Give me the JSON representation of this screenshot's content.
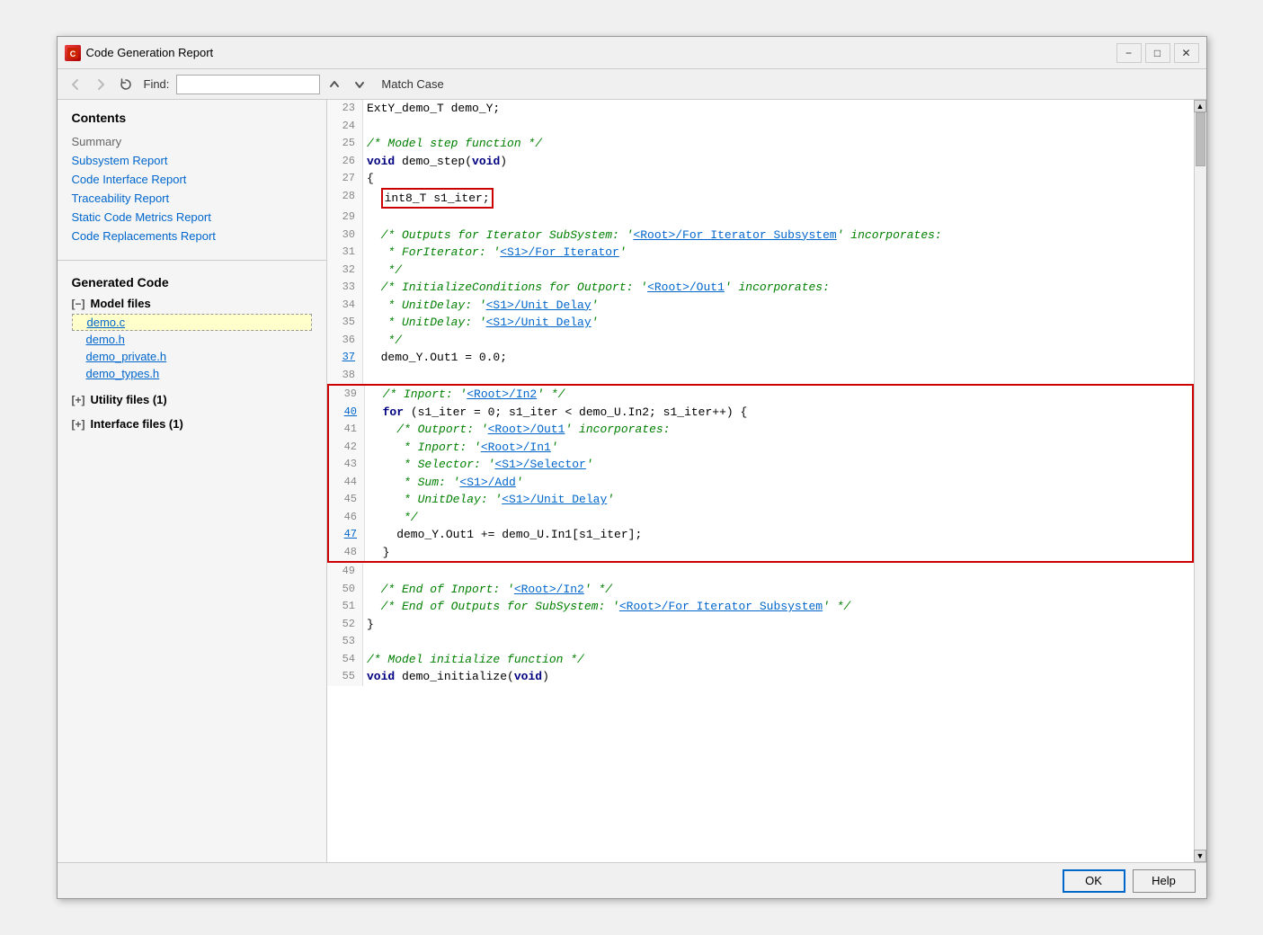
{
  "window": {
    "title": "Code Generation Report",
    "icon": "C"
  },
  "titlebar": {
    "minimize": "−",
    "maximize": "□",
    "close": "✕"
  },
  "toolbar": {
    "back_label": "←",
    "forward_label": "→",
    "refresh_label": "↻",
    "find_label": "Find:",
    "find_placeholder": "",
    "find_value": "",
    "up_label": "↑",
    "down_label": "↓",
    "match_case_label": "Match Case"
  },
  "sidebar": {
    "contents_heading": "Contents",
    "summary_label": "Summary",
    "links": [
      "Subsystem Report",
      "Code Interface Report",
      "Traceability Report",
      "Static Code Metrics Report",
      "Code Replacements Report"
    ],
    "generated_code_heading": "Generated Code",
    "model_files_label": "Model files",
    "model_files_collapsed": "[−]",
    "files": [
      {
        "name": "demo.c",
        "active": true
      },
      {
        "name": "demo.h",
        "active": false
      },
      {
        "name": "demo_private.h",
        "active": false
      },
      {
        "name": "demo_types.h",
        "active": false
      }
    ],
    "utility_files_label": "Utility files (1)",
    "utility_files_collapsed": "[+]",
    "interface_files_label": "Interface files (1)",
    "interface_files_collapsed": "[+]"
  },
  "code": {
    "lines": [
      {
        "num": "23",
        "text": "ExtY_demo_T demo_Y;",
        "type": "normal",
        "link_num": false
      },
      {
        "num": "24",
        "text": "",
        "type": "normal",
        "link_num": false
      },
      {
        "num": "25",
        "text": "/* Model step function */",
        "type": "comment",
        "link_num": false
      },
      {
        "num": "26",
        "text": "void demo_step(void)",
        "type": "normal",
        "link_num": false
      },
      {
        "num": "27",
        "text": "{",
        "type": "normal",
        "link_num": false
      },
      {
        "num": "28",
        "text": "  int8_T s1_iter;",
        "type": "highlighted_red_inline",
        "link_num": false
      },
      {
        "num": "29",
        "text": "",
        "type": "normal",
        "link_num": false
      },
      {
        "num": "30",
        "text": "  /* Outputs for Iterator SubSystem: '<Root>/For Iterator Subsystem' incorporates:",
        "type": "comment_link",
        "link_num": false
      },
      {
        "num": "31",
        "text": "   * ForIterator: '<S1>/For Iterator'",
        "type": "comment_link2",
        "link_num": false
      },
      {
        "num": "32",
        "text": "   */",
        "type": "comment",
        "link_num": false
      },
      {
        "num": "33",
        "text": "  /* InitializeConditions for Outport: '<Root>/Out1' incorporates:",
        "type": "comment_link",
        "link_num": false
      },
      {
        "num": "34",
        "text": "   * UnitDelay: '<S1>/Unit Delay'",
        "type": "comment_link2",
        "link_num": false
      },
      {
        "num": "35",
        "text": "   * UnitDelay: '<S1>/Unit Delay'",
        "type": "comment_link2",
        "link_num": false
      },
      {
        "num": "36",
        "text": "   */",
        "type": "comment",
        "link_num": false
      },
      {
        "num": "37",
        "text": "  demo_Y.Out1 = 0.0;",
        "type": "normal",
        "link_num": true
      },
      {
        "num": "38",
        "text": "",
        "type": "normal",
        "link_num": false
      },
      {
        "num": "39",
        "text": "  /* Inport: '<Root>/In2' */",
        "type": "comment_link_box",
        "link_num": false
      },
      {
        "num": "40",
        "text": "  for (s1_iter = 0; s1_iter < demo_U.In2; s1_iter++) {",
        "type": "normal_box",
        "link_num": true
      },
      {
        "num": "41",
        "text": "    /* Outport: '<Root>/Out1' incorporates:",
        "type": "comment_box",
        "link_num": false
      },
      {
        "num": "42",
        "text": "     * Inport: '<Root>/In1'",
        "type": "comment_link_box2",
        "link_num": false
      },
      {
        "num": "43",
        "text": "     * Selector: '<S1>/Selector'",
        "type": "comment_link_box2",
        "link_num": false
      },
      {
        "num": "44",
        "text": "     * Sum: '<S1>/Add'",
        "type": "comment_link_box2",
        "link_num": false
      },
      {
        "num": "45",
        "text": "     * UnitDelay: '<S1>/Unit Delay'",
        "type": "comment_link_box2",
        "link_num": false
      },
      {
        "num": "46",
        "text": "     */",
        "type": "comment_box",
        "link_num": false
      },
      {
        "num": "47",
        "text": "    demo_Y.Out1 += demo_U.In1[s1_iter];",
        "type": "normal_box",
        "link_num": true
      },
      {
        "num": "48",
        "text": "  }",
        "type": "normal_box_end",
        "link_num": false
      },
      {
        "num": "49",
        "text": "",
        "type": "normal",
        "link_num": false
      },
      {
        "num": "50",
        "text": "  /* End of Inport: '<Root>/In2' */",
        "type": "comment_link",
        "link_num": false
      },
      {
        "num": "51",
        "text": "  /* End of Outputs for SubSystem: '<Root>/For Iterator Subsystem' */",
        "type": "comment_link",
        "link_num": false
      },
      {
        "num": "52",
        "text": "}",
        "type": "normal",
        "link_num": false
      },
      {
        "num": "53",
        "text": "",
        "type": "normal",
        "link_num": false
      },
      {
        "num": "54",
        "text": "/* Model initialize function */",
        "type": "comment",
        "link_num": false
      },
      {
        "num": "55",
        "text": "void demo_initialize(void)",
        "type": "normal",
        "link_num": false
      }
    ]
  },
  "bottom_bar": {
    "ok_label": "OK",
    "help_label": "Help"
  }
}
